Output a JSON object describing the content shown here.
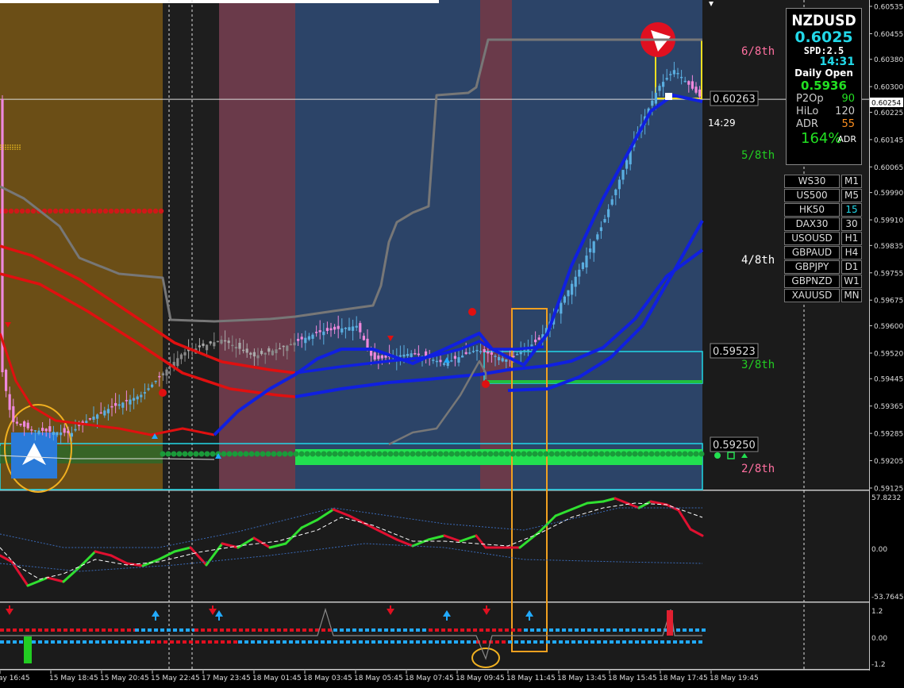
{
  "chart_data": {
    "type": "candlestick",
    "symbol": "NZDUSD",
    "price_axis": {
      "ticks": [
        "0.60535",
        "0.60455",
        "0.60380",
        "0.60300",
        "0.60225",
        "0.60145",
        "0.60065",
        "0.59990",
        "0.59910",
        "0.59835",
        "0.59755",
        "0.59675",
        "0.59600",
        "0.59520",
        "0.59445",
        "0.59365",
        "0.59285",
        "0.59205",
        "0.59125"
      ],
      "current": "0.60254"
    },
    "time_axis": [
      "ay 16:45",
      "15 May 18:45",
      "15 May 20:45",
      "15 May 22:45",
      "17 May 23:45",
      "18 May 01:45",
      "18 May 03:45",
      "18 May 05:45",
      "18 May 07:45",
      "18 May 09:45",
      "18 May 11:45",
      "18 May 13:45",
      "18 May 15:45",
      "18 May 17:45",
      "18 May 19:45"
    ],
    "levels": [
      {
        "label": "6/8th",
        "color": "#ff70a0"
      },
      {
        "label": "5/8th",
        "color": "#22cc22"
      },
      {
        "label": "4/8th",
        "color": "#ffffff"
      },
      {
        "label": "3/8th",
        "color": "#22cc22"
      },
      {
        "label": "2/8th",
        "color": "#ff70a0"
      }
    ],
    "boxed_prices": [
      "0.60263",
      "0.59523",
      "0.59250"
    ],
    "countdown": "14:29",
    "oscillator": {
      "ticks": [
        "57.8232",
        "0.00",
        "-53.7645"
      ]
    },
    "signal_panel": {
      "ticks": [
        "1.2",
        "0.00",
        "-1.2"
      ]
    }
  },
  "info_panel": {
    "symbol": "NZDUSD",
    "price": "0.6025",
    "spread": "SPD:2.5",
    "time": "14:31",
    "daily_open_label": "Daily Open",
    "daily_open": "0.5936",
    "p2op_label": "P2Op",
    "p2op": "90",
    "hilo_label": "HiLo",
    "hilo": "120",
    "adr_label": "ADR",
    "adr": "55",
    "pct": "164%",
    "pct_label": "ADR"
  },
  "symbol_buttons": [
    {
      "symbol": "WS30",
      "tf": "M1"
    },
    {
      "symbol": "US500",
      "tf": "M5"
    },
    {
      "symbol": "HK50",
      "tf": "15"
    },
    {
      "symbol": "DAX30",
      "tf": "30"
    },
    {
      "symbol": "USOUSD",
      "tf": "H1"
    },
    {
      "symbol": "GBPAUD",
      "tf": "H4"
    },
    {
      "symbol": "GBPJPY",
      "tf": "D1"
    },
    {
      "symbol": "GBPNZD",
      "tf": "W1"
    },
    {
      "symbol": "XAUUSD",
      "tf": "MN"
    }
  ],
  "colors": {
    "up": "#5aaee0",
    "down": "#ee88dd",
    "ma_red": "#e01010",
    "ma_blue": "#1020e0",
    "osc_green": "#30e030",
    "osc_red": "#e01030",
    "session_gold": "#6b4e16",
    "session_maroon": "#6a3a4a",
    "session_blue": "#2c4468"
  }
}
